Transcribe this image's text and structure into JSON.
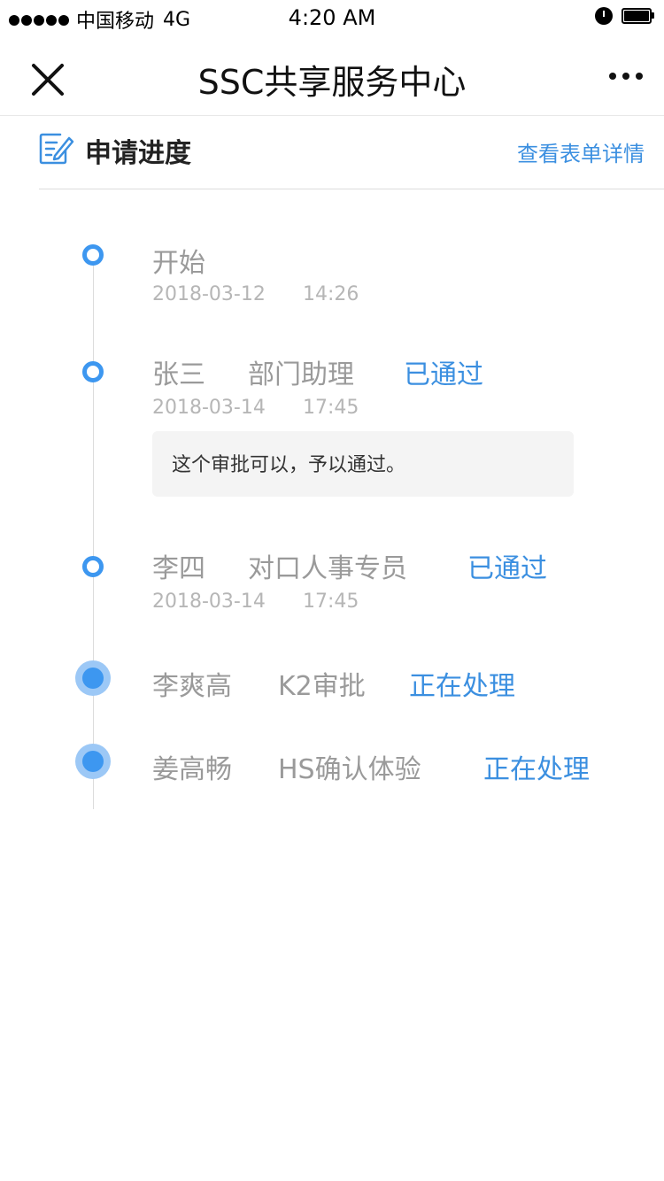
{
  "status_bar": {
    "carrier": "中国移动",
    "network": "4G",
    "time": "4:20 AM"
  },
  "navbar": {
    "title": "SSC共享服务中心"
  },
  "section": {
    "title": "申请进度",
    "detail_link": "查看表单详情"
  },
  "timeline": [
    {
      "name": "开始",
      "role": "",
      "status": "",
      "date": "2018-03-12",
      "time": "14:26",
      "comment": ""
    },
    {
      "name": "张三",
      "role": "部门助理",
      "status": "已通过",
      "date": "2018-03-14",
      "time": "17:45",
      "comment": "这个审批可以，予以通过。"
    },
    {
      "name": "李四",
      "role": "对口人事专员",
      "status": "已通过",
      "date": "2018-03-14",
      "time": "17:45",
      "comment": ""
    },
    {
      "name": "李爽高",
      "role": "K2审批",
      "status": "正在处理",
      "date": "",
      "time": "",
      "comment": ""
    },
    {
      "name": "姜高畅",
      "role": "HS确认体验",
      "status": "正在处理",
      "date": "",
      "time": "",
      "comment": ""
    }
  ],
  "colors": {
    "accent": "#3d97f0",
    "link": "#3b8fe0",
    "muted": "#9a9a9a"
  }
}
